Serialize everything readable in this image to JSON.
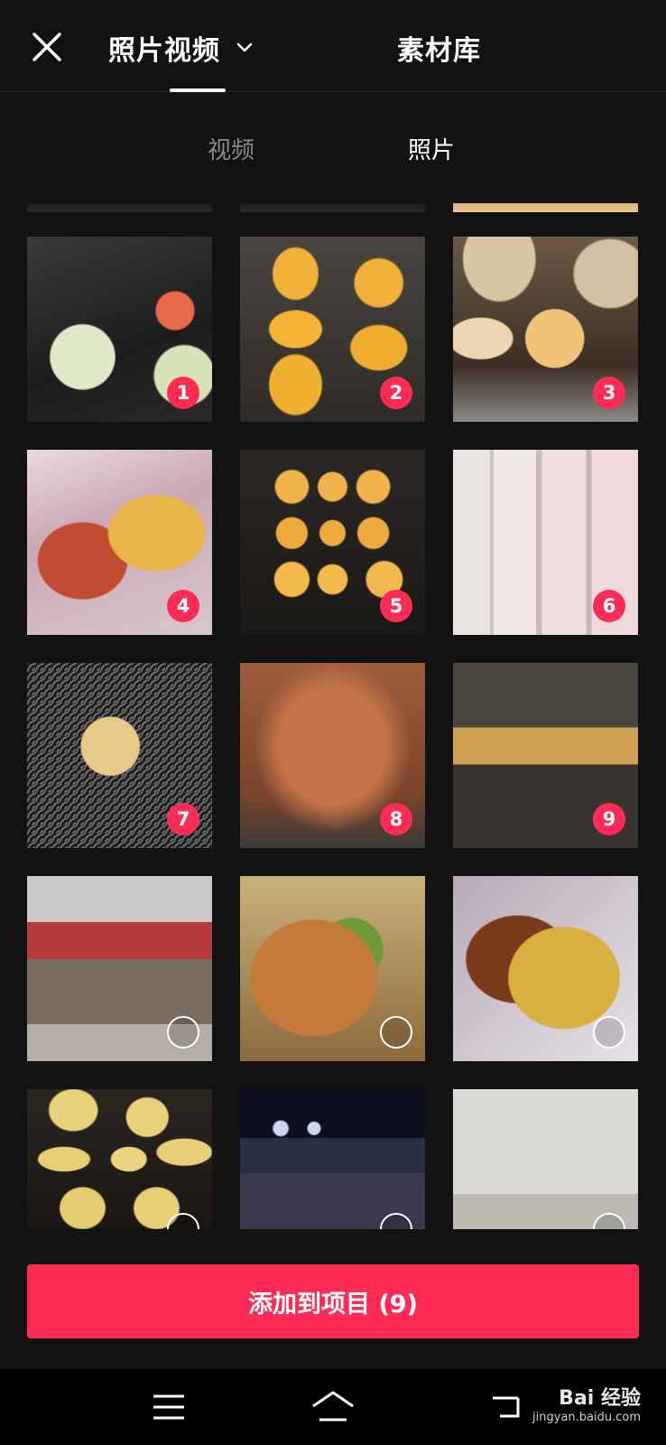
{
  "header": {
    "tab_photos_label": "照片视频",
    "tab_library_label": "素材库"
  },
  "subtabs": {
    "video": "视频",
    "photo": "照片"
  },
  "grid": {
    "items": [
      {
        "badge": "1"
      },
      {
        "badge": "2"
      },
      {
        "badge": "3"
      },
      {
        "badge": "4"
      },
      {
        "badge": "5"
      },
      {
        "badge": "6"
      },
      {
        "badge": "7"
      },
      {
        "badge": "8"
      },
      {
        "badge": "9"
      },
      {
        "badge": ""
      },
      {
        "badge": ""
      },
      {
        "badge": ""
      },
      {
        "badge": ""
      },
      {
        "badge": ""
      },
      {
        "badge": ""
      }
    ]
  },
  "add_button": {
    "label": "添加到项目 (9)"
  },
  "watermark": {
    "brand": "Bai 经验",
    "url": "jingyan.baidu.com"
  },
  "colors": {
    "accent": "#fe2c55",
    "background": "#121212"
  },
  "icons": [
    "close-icon",
    "chevron-down-icon",
    "menu-icon",
    "home-icon",
    "back-icon"
  ]
}
